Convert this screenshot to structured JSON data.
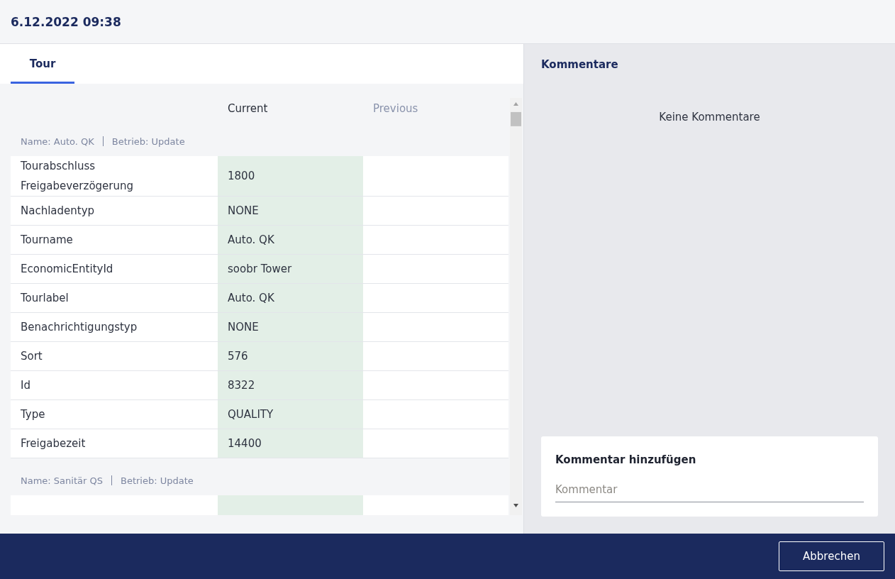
{
  "header": {
    "title": "6.12.2022 09:38"
  },
  "tabs": [
    {
      "label": "Tour",
      "selected": true
    }
  ],
  "table": {
    "columns": [
      {
        "label": "Current",
        "highlighted": true
      },
      {
        "label": "Previous",
        "highlighted": false
      }
    ],
    "groups": [
      {
        "name": "Name: Auto. QK",
        "operation": "Betrieb: Update",
        "rows": [
          {
            "field": "Tourabschluss Freigabeverzögerung",
            "current": "1800"
          },
          {
            "field": "Nachladentyp",
            "current": "NONE"
          },
          {
            "field": "Tourname",
            "current": "Auto. QK"
          },
          {
            "field": "EconomicEntityId",
            "current": "soobr Tower"
          },
          {
            "field": "Tourlabel",
            "current": "Auto. QK"
          },
          {
            "field": "Benachrichtigungstyp",
            "current": "NONE"
          },
          {
            "field": "Sort",
            "current": "576"
          },
          {
            "field": "Id",
            "current": "8322"
          },
          {
            "field": "Type",
            "current": "QUALITY"
          },
          {
            "field": "Freigabezeit",
            "current": "14400"
          }
        ]
      },
      {
        "name": "Name: Sanitär QS",
        "operation": "Betrieb: Update"
      }
    ]
  },
  "comments": {
    "title": "Kommentare",
    "empty": "Keine Kommentare",
    "add_title": "Kommentar hinzufügen",
    "placeholder": "Kommentar"
  },
  "footer": {
    "buttons": [
      "Abbrechen"
    ]
  }
}
